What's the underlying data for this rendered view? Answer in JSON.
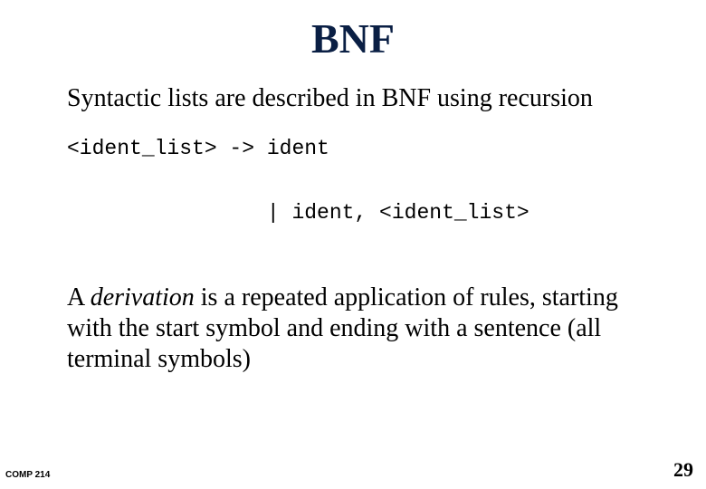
{
  "title": "BNF",
  "para1": "Syntactic lists are described in BNF using recursion",
  "code_line1": "<ident_list> -> ident",
  "code_line2": "                | ident, <ident_list>",
  "para2_prefix": "A  ",
  "para2_italic": "derivation",
  "para2_rest": " is a repeated application of rules, starting with the start symbol and ending with a sentence (all terminal symbols)",
  "footer_left": "COMP 214",
  "footer_right": "29"
}
